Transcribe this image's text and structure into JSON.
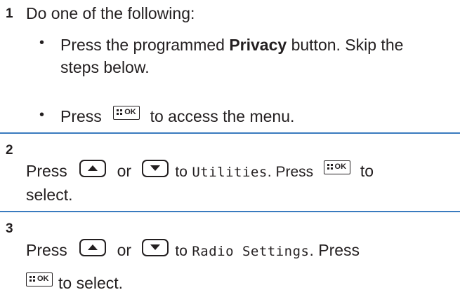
{
  "step1": {
    "number": "1",
    "intro": "Do one of the following:",
    "bullet_symbol": "•",
    "bullet1": {
      "pre": "Press the programmed ",
      "bold": "Privacy",
      "post": " button. Skip the",
      "line2": "steps below."
    },
    "bullet2": {
      "pre": "Press",
      "post": "to access the menu."
    }
  },
  "step2": {
    "number": "2",
    "press": "Press",
    "or": "or",
    "to": "to",
    "menu_item": "Utilities",
    "sentence_end": ". Press",
    "to2": "to",
    "line2": "select."
  },
  "step3": {
    "number": "3",
    "press": "Press",
    "or": "or",
    "to": "to",
    "menu_item": "Radio Settings",
    "sentence_end": ". Press",
    "line2": "to select."
  },
  "icons": {
    "ok_key": "menu-ok-key-icon",
    "up_key": "up-arrow-key-icon",
    "down_key": "down-arrow-key-icon",
    "ok_label": "OK"
  },
  "colors": {
    "rule": "#3a7bbf",
    "text": "#231f20"
  }
}
